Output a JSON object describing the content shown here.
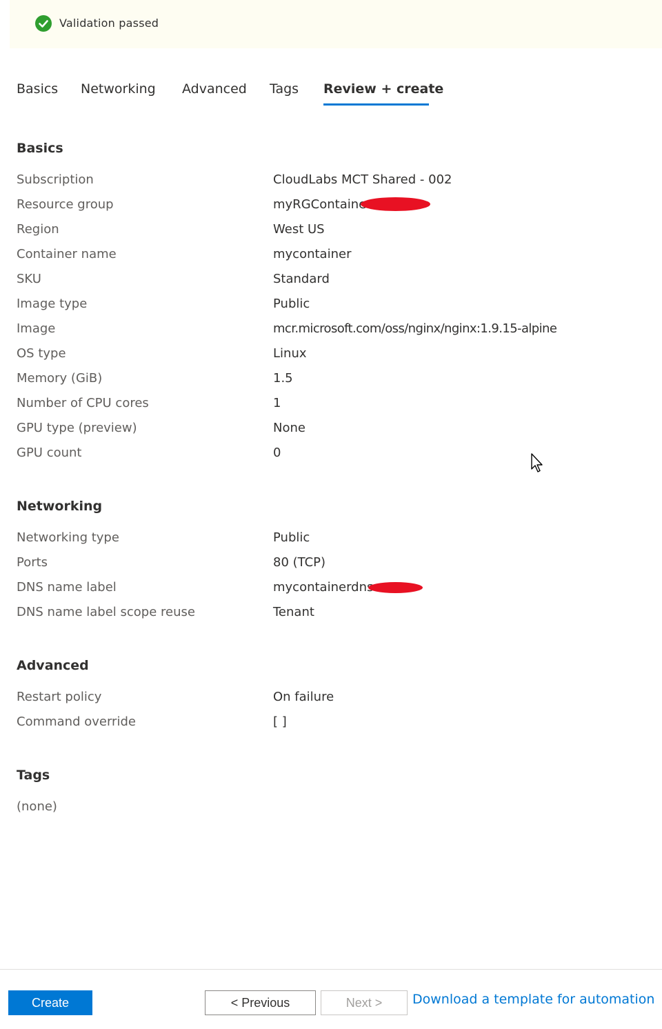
{
  "banner": {
    "message": "Validation passed",
    "icon": "check-circle-icon",
    "status_color": "#2f9e2f"
  },
  "tabs": [
    {
      "label": "Basics"
    },
    {
      "label": "Networking"
    },
    {
      "label": "Advanced"
    },
    {
      "label": "Tags"
    },
    {
      "label": "Review + create",
      "active": true
    }
  ],
  "sections": {
    "basics": {
      "title": "Basics",
      "rows": [
        {
          "label": "Subscription",
          "value": "CloudLabs MCT Shared - 002"
        },
        {
          "label": "Resource group",
          "value": "myRGContaine"
        },
        {
          "label": "Region",
          "value": "West US"
        },
        {
          "label": "Container name",
          "value": "mycontainer"
        },
        {
          "label": "SKU",
          "value": "Standard"
        },
        {
          "label": "Image type",
          "value": "Public"
        },
        {
          "label": "Image",
          "value": "mcr.microsoft.com/oss/nginx/nginx:1.9.15-alpine"
        },
        {
          "label": "OS type",
          "value": "Linux"
        },
        {
          "label": "Memory (GiB)",
          "value": "1.5"
        },
        {
          "label": "Number of CPU cores",
          "value": "1"
        },
        {
          "label": "GPU type (preview)",
          "value": "None"
        },
        {
          "label": "GPU count",
          "value": "0"
        }
      ]
    },
    "networking": {
      "title": "Networking",
      "rows": [
        {
          "label": "Networking type",
          "value": "Public"
        },
        {
          "label": "Ports",
          "value": "80 (TCP)"
        },
        {
          "label": "DNS name label",
          "value": "mycontainerdns"
        },
        {
          "label": "DNS name label scope reuse",
          "value": "Tenant"
        }
      ]
    },
    "advanced": {
      "title": "Advanced",
      "rows": [
        {
          "label": "Restart policy",
          "value": "On failure"
        },
        {
          "label": "Command override",
          "value": "[ ]"
        }
      ]
    },
    "tags": {
      "title": "Tags",
      "empty_text": "(none)"
    }
  },
  "footer": {
    "create_label": "Create",
    "previous_label": "< Previous",
    "next_label": "Next >",
    "download_link": "Download a template for automation"
  },
  "colors": {
    "accent": "#0078d4",
    "redaction": "#e81123"
  }
}
